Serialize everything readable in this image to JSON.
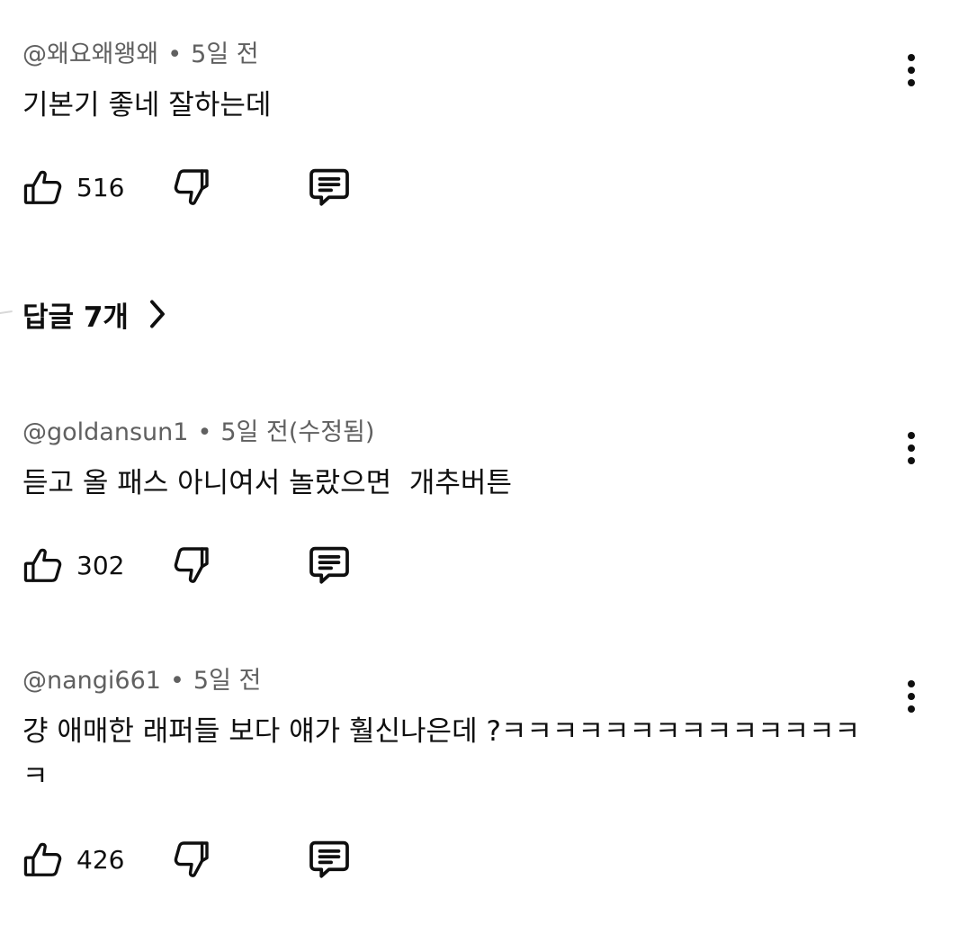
{
  "comments": [
    {
      "author": "@왜요왜왱왜",
      "time": "5일 전",
      "text": "기본기 좋네 잘하는데",
      "likes": "516"
    },
    {
      "author": "@goldansun1",
      "time": "5일 전(수정됨)",
      "text": "듣고 올 패스 아니여서 놀랐으면  개추버튼",
      "likes": "302"
    },
    {
      "author": "@nangi661",
      "time": "5일 전",
      "text": "걍 애매한 래퍼들 보다 얘가 훨신나은데 ?ㅋㅋㅋㅋㅋㅋㅋㅋㅋㅋㅋㅋㅋㅋㅋ",
      "likes": "426"
    }
  ],
  "replies": {
    "label": "답글 7개"
  },
  "separator": "•",
  "icons": {
    "like": "thumbs-up-icon",
    "dislike": "thumbs-down-icon",
    "reply": "comment-icon",
    "more": "more-vertical-icon",
    "chevron": "chevron-right-icon"
  }
}
